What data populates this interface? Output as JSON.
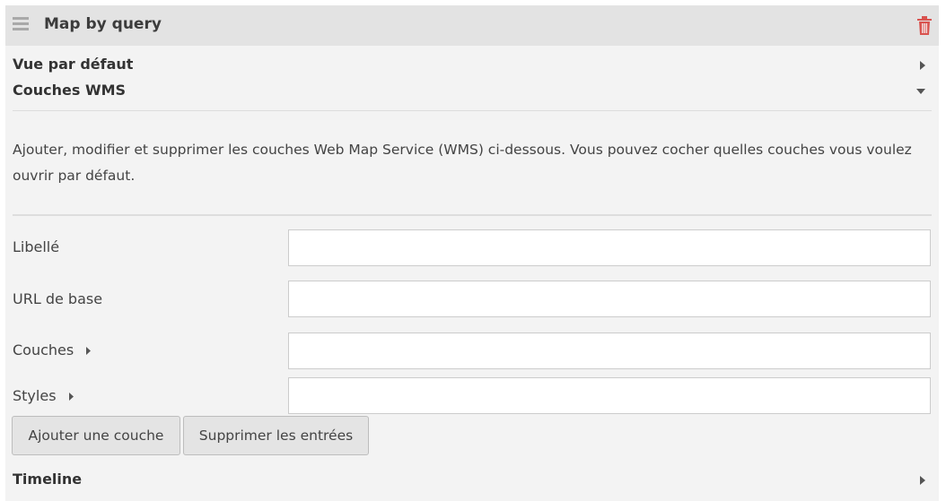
{
  "panel": {
    "title": "Map by query",
    "drag_icon": "drag-handle-icon",
    "delete_icon": "trash-icon"
  },
  "sections": {
    "default_view": "Vue par défaut",
    "wms_layers": "Couches WMS",
    "timeline": "Timeline"
  },
  "description": "Ajouter, modifier et supprimer les couches Web Map Service (WMS) ci-dessous. Vous pouvez cocher quelles couches vous voulez ouvrir par défaut.",
  "form": {
    "label_field": {
      "label": "Libellé",
      "value": ""
    },
    "base_url_field": {
      "label": "URL de base",
      "value": ""
    },
    "layers_field": {
      "label": "Couches",
      "value": ""
    },
    "styles_field": {
      "label": "Styles",
      "value": ""
    }
  },
  "buttons": {
    "add_layer": "Ajouter une couche",
    "remove_entries": "Supprimer les entrées"
  },
  "colors": {
    "header_bg": "#e3e3e3",
    "panel_bg": "#f3f3f3",
    "trash": "#d9534f"
  }
}
